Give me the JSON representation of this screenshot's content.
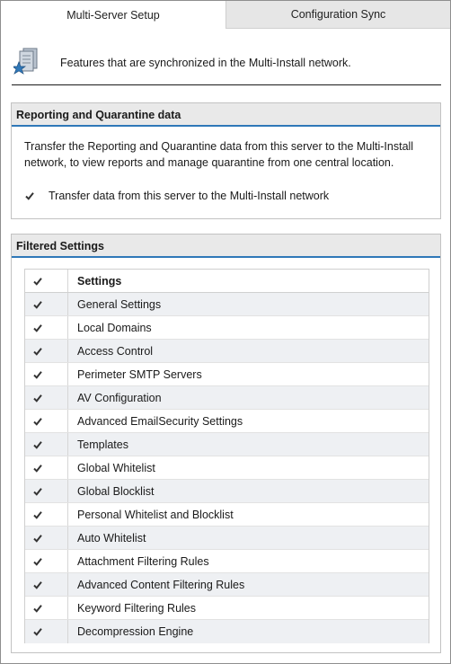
{
  "tabs": [
    {
      "label": "Multi-Server Setup",
      "active": true
    },
    {
      "label": "Configuration Sync",
      "active": false
    }
  ],
  "header": {
    "icon": "multi-server-icon",
    "text": "Features that are synchronized in the Multi-Install network."
  },
  "reporting": {
    "title": "Reporting and Quarantine data",
    "description": "Transfer the Reporting and Quarantine data from this server to the Multi-Install network, to view reports and manage quarantine from one central location.",
    "option_label": "Transfer data from this server to the Multi-Install network",
    "option_checked": true
  },
  "filtered": {
    "title": "Filtered Settings",
    "column_header": "Settings",
    "header_checked": true,
    "rows": [
      {
        "label": "General Settings",
        "checked": true
      },
      {
        "label": "Local Domains",
        "checked": true
      },
      {
        "label": "Access Control",
        "checked": true
      },
      {
        "label": "Perimeter SMTP Servers",
        "checked": true
      },
      {
        "label": "AV Configuration",
        "checked": true
      },
      {
        "label": "Advanced EmailSecurity Settings",
        "checked": true
      },
      {
        "label": "Templates",
        "checked": true
      },
      {
        "label": "Global Whitelist",
        "checked": true
      },
      {
        "label": "Global Blocklist",
        "checked": true
      },
      {
        "label": "Personal Whitelist and Blocklist",
        "checked": true
      },
      {
        "label": "Auto Whitelist",
        "checked": true
      },
      {
        "label": "Attachment Filtering Rules",
        "checked": true
      },
      {
        "label": "Advanced Content Filtering Rules",
        "checked": true
      },
      {
        "label": "Keyword Filtering Rules",
        "checked": true
      },
      {
        "label": "Decompression Engine",
        "checked": true
      }
    ]
  },
  "colors": {
    "accent": "#2f78b8",
    "section_header_bg": "#e9e9e9",
    "row_alt_bg": "#eef0f3",
    "inactive_tab_bg": "#e6e6e6"
  }
}
